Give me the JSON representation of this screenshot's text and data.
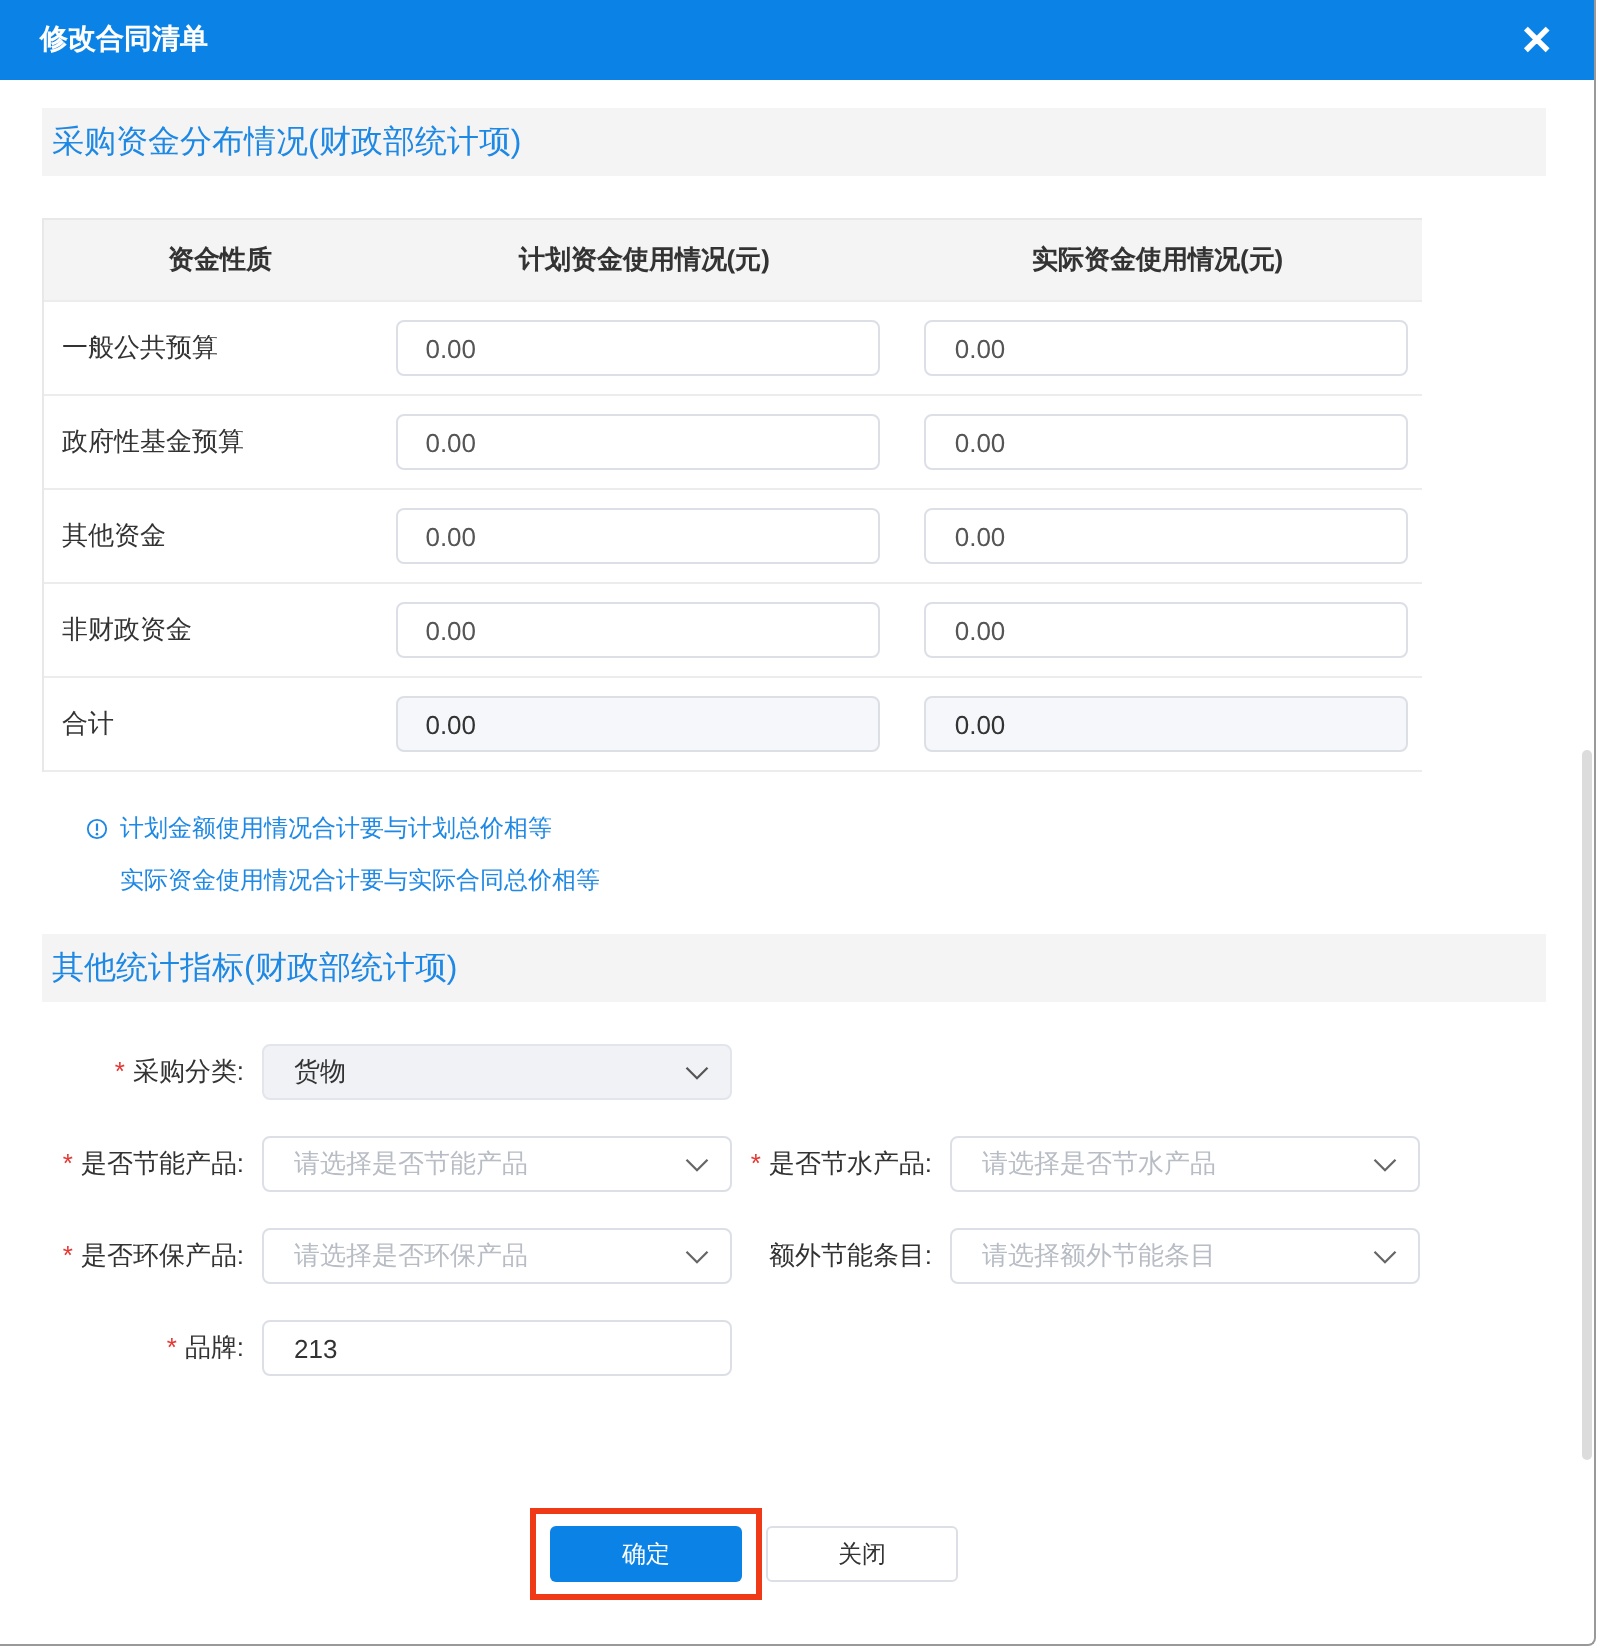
{
  "dialog": {
    "title": "修改合同清单",
    "close": "✕"
  },
  "funding_section": {
    "heading": "采购资金分布情况(财政部统计项)",
    "table": {
      "columns": [
        "资金性质",
        "计划资金使用情况(元)",
        "实际资金使用情况(元)"
      ],
      "rows": [
        {
          "label": "一般公共预算",
          "cells": [
            {
              "value": "0.00",
              "disabled": false
            },
            {
              "value": "0.00",
              "disabled": false
            }
          ]
        },
        {
          "label": "政府性基金预算",
          "cells": [
            {
              "value": "0.00",
              "disabled": false
            },
            {
              "value": "0.00",
              "disabled": false
            }
          ]
        },
        {
          "label": "其他资金",
          "cells": [
            {
              "value": "0.00",
              "disabled": false
            },
            {
              "value": "0.00",
              "disabled": false
            }
          ]
        },
        {
          "label": "非财政资金",
          "cells": [
            {
              "value": "0.00",
              "disabled": false
            },
            {
              "value": "0.00",
              "disabled": false
            }
          ]
        },
        {
          "label": "合计",
          "cells": [
            {
              "value": "0.00",
              "disabled": true
            },
            {
              "value": "0.00",
              "disabled": true
            }
          ]
        }
      ]
    },
    "notes": [
      "计划金额使用情况合计要与计划总价相等",
      "实际资金使用情况合计要与实际合同总价相等"
    ]
  },
  "stats_section": {
    "heading": "其他统计指标(财政部统计项)",
    "rows": [
      [
        {
          "kind": "select",
          "required_mark": "*",
          "label": "采购分类:",
          "value": "货物",
          "disabled": true
        }
      ],
      [
        {
          "kind": "select",
          "required_mark": "*",
          "label": "是否节能产品:",
          "placeholder": "请选择是否节能产品",
          "disabled": false
        },
        {
          "kind": "select",
          "required_mark": "*",
          "label": "是否节水产品:",
          "placeholder": "请选择是否节水产品",
          "disabled": false
        }
      ],
      [
        {
          "kind": "select",
          "required_mark": "*",
          "label": "是否环保产品:",
          "placeholder": "请选择是否环保产品",
          "disabled": false
        },
        {
          "kind": "select",
          "label": "额外节能条目:",
          "placeholder": "请选择额外节能条目",
          "disabled": false
        }
      ],
      [
        {
          "kind": "input",
          "required_mark": "*",
          "label": "品牌:",
          "value": "213",
          "disabled": false
        }
      ]
    ]
  },
  "buttons": [
    {
      "label": "确定",
      "kind": "primary",
      "highlighted": true
    },
    {
      "label": "关闭",
      "kind": "default",
      "highlighted": false
    }
  ]
}
